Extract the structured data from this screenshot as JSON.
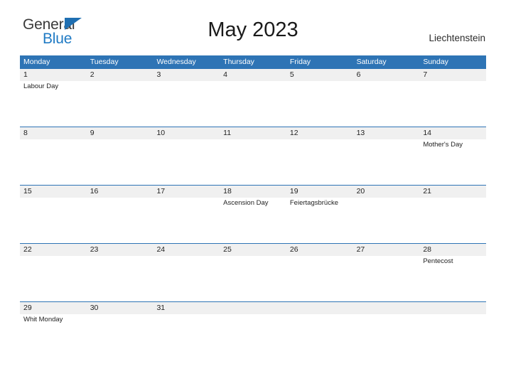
{
  "brand": {
    "word_general": "General",
    "word_blue": "Blue",
    "blue_hex": "#1F7AC4"
  },
  "header": {
    "title": "May 2023",
    "region": "Liechtenstein"
  },
  "colors": {
    "header_band": "#2E74B5",
    "date_band": "#F0F0F0",
    "text": "#1F1F1F"
  },
  "calendar": {
    "weekday_headers": [
      "Monday",
      "Tuesday",
      "Wednesday",
      "Thursday",
      "Friday",
      "Saturday",
      "Sunday"
    ],
    "weeks": [
      {
        "dates": [
          "1",
          "2",
          "3",
          "4",
          "5",
          "6",
          "7"
        ],
        "events": [
          "Labour Day",
          "",
          "",
          "",
          "",
          "",
          ""
        ]
      },
      {
        "dates": [
          "8",
          "9",
          "10",
          "11",
          "12",
          "13",
          "14"
        ],
        "events": [
          "",
          "",
          "",
          "",
          "",
          "",
          "Mother's Day"
        ]
      },
      {
        "dates": [
          "15",
          "16",
          "17",
          "18",
          "19",
          "20",
          "21"
        ],
        "events": [
          "",
          "",
          "",
          "Ascension Day",
          "Feiertagsbrücke",
          "",
          ""
        ]
      },
      {
        "dates": [
          "22",
          "23",
          "24",
          "25",
          "26",
          "27",
          "28"
        ],
        "events": [
          "",
          "",
          "",
          "",
          "",
          "",
          "Pentecost"
        ]
      },
      {
        "dates": [
          "29",
          "30",
          "31",
          "",
          "",
          "",
          ""
        ],
        "events": [
          "Whit Monday",
          "",
          "",
          "",
          "",
          "",
          ""
        ]
      }
    ]
  }
}
